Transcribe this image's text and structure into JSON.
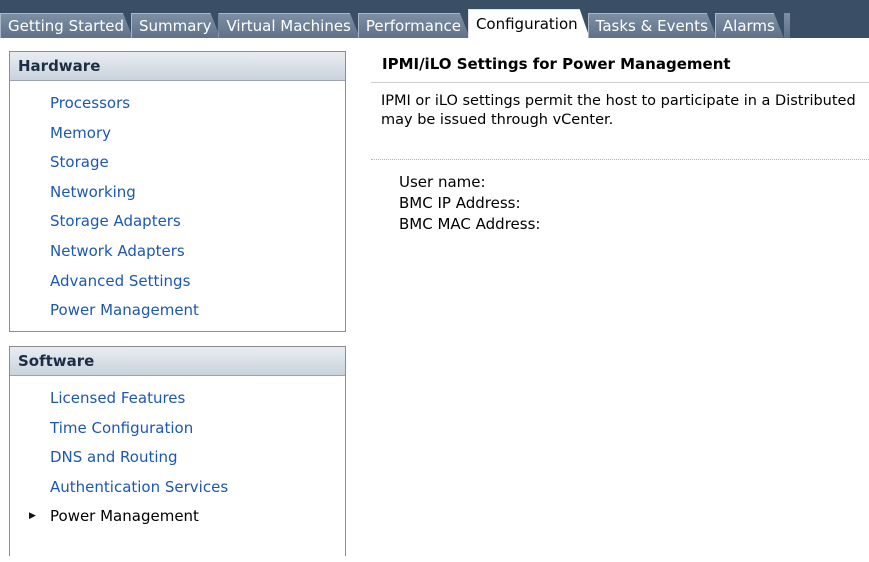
{
  "tabs": [
    {
      "label": "Getting Started",
      "active": false
    },
    {
      "label": "Summary",
      "active": false
    },
    {
      "label": "Virtual Machines",
      "active": false
    },
    {
      "label": "Performance",
      "active": false
    },
    {
      "label": "Configuration",
      "active": true
    },
    {
      "label": "Tasks & Events",
      "active": false
    },
    {
      "label": "Alarms",
      "active": false
    }
  ],
  "hardware": {
    "title": "Hardware",
    "items": [
      "Processors",
      "Memory",
      "Storage",
      "Networking",
      "Storage Adapters",
      "Network Adapters",
      "Advanced Settings",
      "Power Management"
    ]
  },
  "software": {
    "title": "Software",
    "items": [
      "Licensed Features",
      "Time Configuration",
      "DNS and Routing",
      "Authentication Services",
      "Power Management"
    ],
    "selected_index": 4
  },
  "main": {
    "title": "IPMI/iLO Settings for Power Management",
    "description_line1": "IPMI or iLO settings permit the host to participate in a Distributed",
    "description_line2": "may be issued through vCenter.",
    "fields": [
      {
        "label": "User name:"
      },
      {
        "label": "BMC IP Address:"
      },
      {
        "label": "BMC MAC Address:"
      }
    ]
  },
  "colors": {
    "tab_bar": "#3a4f66",
    "link": "#1c57b8",
    "panel_header_text": "#1c2e45"
  }
}
